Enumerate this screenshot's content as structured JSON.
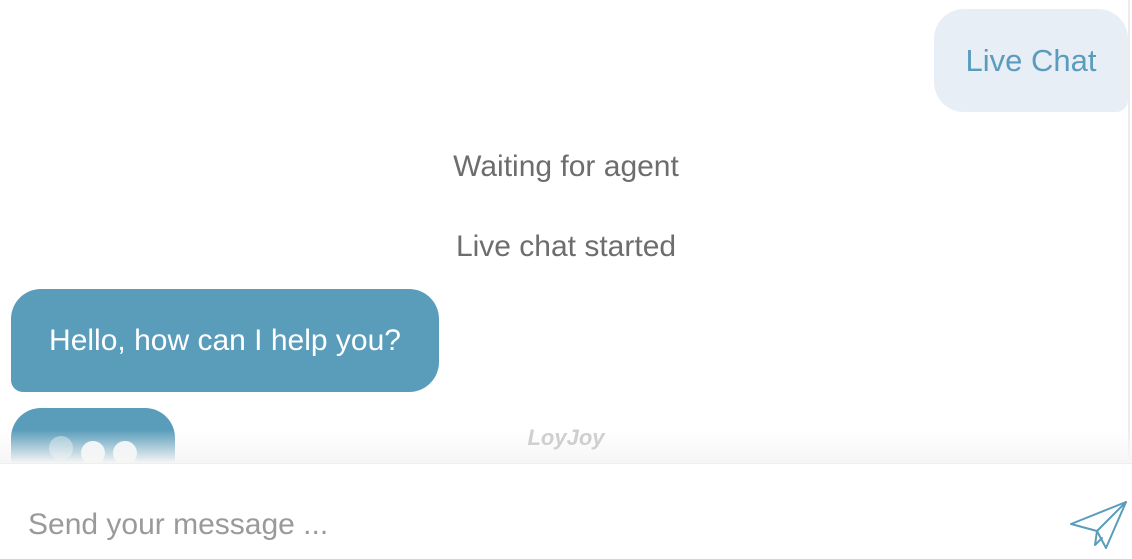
{
  "conversation": {
    "user_message": "Live Chat",
    "system_messages": [
      "Waiting for agent",
      "Live chat started"
    ],
    "agent_message": "Hello, how can I help you?",
    "typing_indicator": "agent-typing"
  },
  "branding": {
    "watermark": "LoyJoy"
  },
  "composer": {
    "placeholder": "Send your message ...",
    "value": "",
    "send_icon": "paper-plane-icon"
  },
  "colors": {
    "accent": "#5a9dbb",
    "user_bubble_bg": "#e8eef5",
    "user_bubble_text": "#5a9cbd",
    "system_text": "#6d6d6d",
    "placeholder": "#9a9a9a"
  }
}
